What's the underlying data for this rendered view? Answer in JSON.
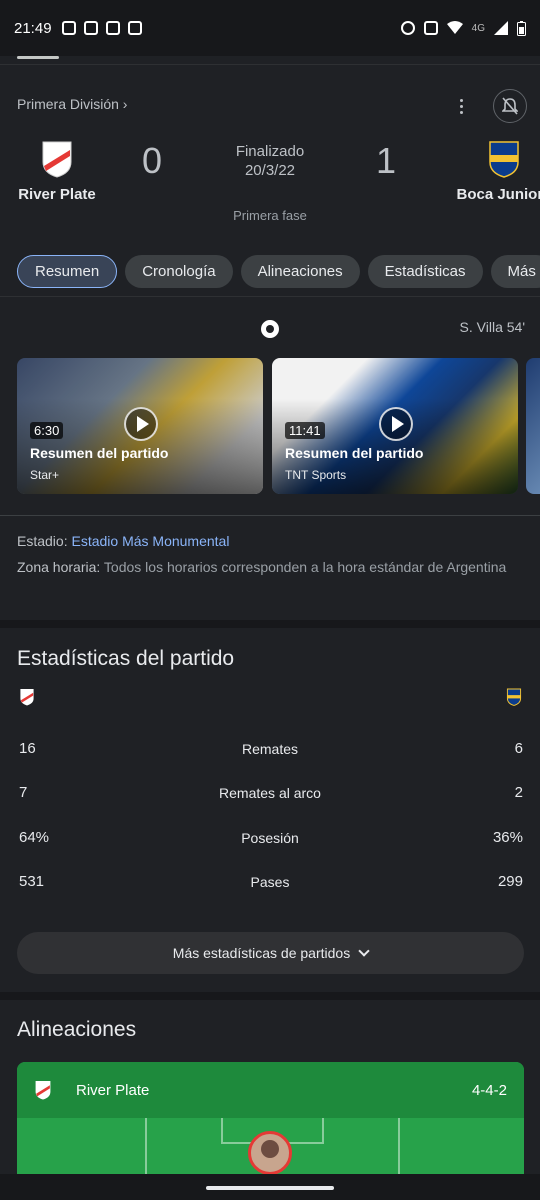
{
  "status_bar": {
    "time": "21:49",
    "network": "4G",
    "left_icons": [
      "instagram-icon",
      "translate-icon",
      "news-icon",
      "twitch-icon"
    ],
    "right_icons": [
      "alarm-icon",
      "mute-icon",
      "wifi-icon",
      "signal-icon",
      "battery-icon"
    ]
  },
  "match": {
    "league": "Primera División ›",
    "status": "Finalizado",
    "date": "20/3/22",
    "phase": "Primera fase",
    "home": {
      "name": "River Plate",
      "score": "0"
    },
    "away": {
      "name": "Boca Juniors",
      "score": "1"
    }
  },
  "tabs": [
    "Resumen",
    "Cronología",
    "Alineaciones",
    "Estadísticas",
    "Más"
  ],
  "goal": {
    "text": "S. Villa 54'"
  },
  "videos": [
    {
      "duration": "6:30",
      "title": "Resumen del partido",
      "source": "Star+"
    },
    {
      "duration": "11:41",
      "title": "Resumen del partido",
      "source": "TNT Sports"
    }
  ],
  "info": {
    "stadium_label": "Estadio:",
    "stadium_value": "Estadio Más Monumental",
    "timezone_label": "Zona horaria:",
    "timezone_value": "Todos los horarios corresponden a la hora estándar de Argentina"
  },
  "stats": {
    "title": "Estadísticas del partido",
    "rows": [
      {
        "label": "Remates",
        "home": "16",
        "away": "6"
      },
      {
        "label": "Remates al arco",
        "home": "7",
        "away": "2"
      },
      {
        "label": "Posesión",
        "home": "64%",
        "away": "36%"
      },
      {
        "label": "Pases",
        "home": "531",
        "away": "299"
      }
    ],
    "more_label": "Más estadísticas de partidos"
  },
  "lineups": {
    "title": "Alineaciones",
    "team": "River Plate",
    "formation": "4-4-2"
  },
  "colors": {
    "background": "#1f2125",
    "accent": "#8ab4f8",
    "pitch": "#27a24a",
    "river_red": "#e53935",
    "boca_blue": "#0b3c8c",
    "boca_gold": "#f2c232"
  }
}
